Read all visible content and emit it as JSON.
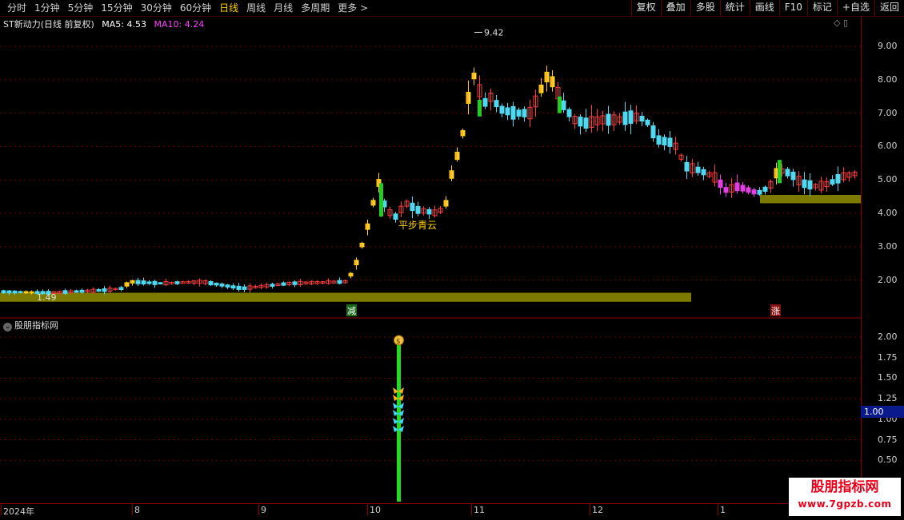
{
  "toolbar": {
    "periods": [
      "分时",
      "1分钟",
      "5分钟",
      "15分钟",
      "30分钟",
      "60分钟",
      "日线",
      "周线",
      "月线",
      "多周期",
      "更多 >"
    ],
    "active_period": "日线",
    "buttons": [
      "复权",
      "叠加",
      "多股",
      "统计",
      "画线",
      "F10",
      "标记",
      "+自选",
      "返回"
    ]
  },
  "info": {
    "stock": "ST新动力(日线 前复权)",
    "ma5": "MA5: 4.53",
    "ma10": "MA10: 4.24"
  },
  "colors": {
    "up": "#ff3c3c",
    "down": "#4fd8f0",
    "signal_yellow": "#ffd200",
    "signal_green": "#22cc22",
    "signal_magenta": "#e040e0",
    "band": "#7d7a00",
    "ma5": "#ffffff",
    "ma10": "#ff40ff"
  },
  "price_axis": [
    "9.00",
    "8.00",
    "7.00",
    "6.00",
    "5.00",
    "4.00",
    "3.00",
    "2.00"
  ],
  "indicator": {
    "title": "股朋指标网",
    "axis": [
      "2.00",
      "1.75",
      "1.50",
      "1.25",
      "1.00",
      "0.75",
      "0.50"
    ],
    "current_value": "1.00"
  },
  "date_axis": [
    "2024年",
    "8",
    "9",
    "10",
    "11",
    "12",
    "1"
  ],
  "annotations": {
    "high": "9.42",
    "low": "1.49",
    "pattern": "平步青云",
    "reduce": "减",
    "rise": "涨"
  },
  "watermark": {
    "line1": "股朋指标网",
    "line2": "www.7gpzb.com"
  },
  "chart_data": {
    "type": "candlestick",
    "bars_count": 155,
    "price_range": [
      1.0,
      9.8
    ],
    "max_price": 9.42,
    "min_price": 1.49
  }
}
